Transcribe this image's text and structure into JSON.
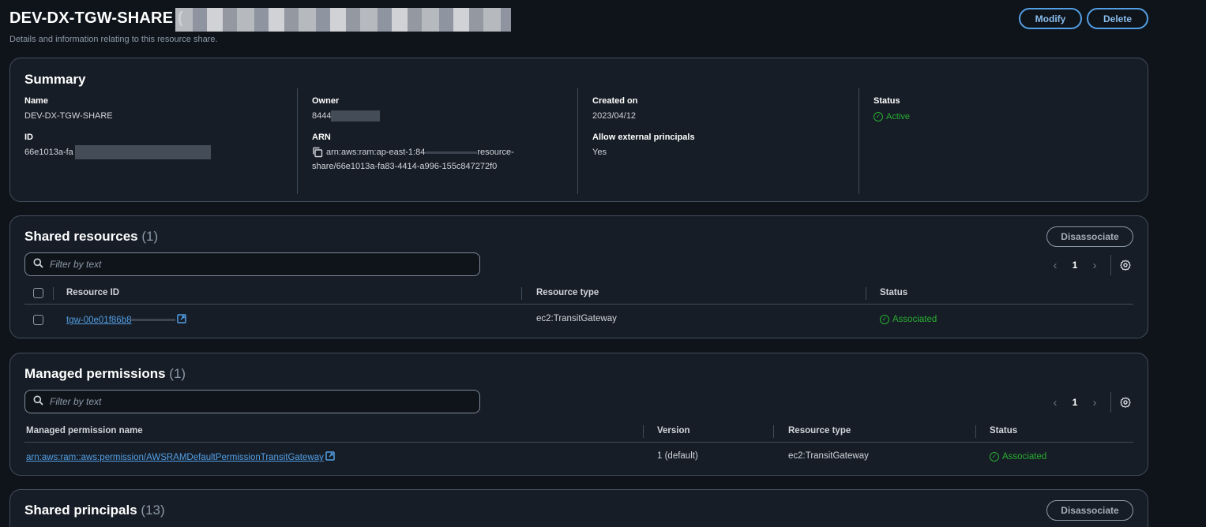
{
  "header": {
    "title": "DEV-DX-TGW-SHARE (",
    "description": "Details and information relating to this resource share.",
    "modify_label": "Modify",
    "delete_label": "Delete"
  },
  "summary": {
    "title": "Summary",
    "name_label": "Name",
    "name_value": "DEV-DX-TGW-SHARE",
    "id_label": "ID",
    "id_value": "66e1013a-fa",
    "owner_label": "Owner",
    "owner_value": "8444",
    "arn_label": "ARN",
    "arn_line1_prefix": "arn:aws:ram:ap-east-1:84",
    "arn_line1_suffix": "resource-",
    "arn_line2": "share/66e1013a-fa83-4414-a996-155c847272f0",
    "created_label": "Created on",
    "created_value": "2023/04/12",
    "external_label": "Allow external principals",
    "external_value": "Yes",
    "status_label": "Status",
    "status_value": "Active"
  },
  "shared_resources": {
    "title": "Shared resources",
    "count": "(1)",
    "disassociate_label": "Disassociate",
    "filter_placeholder": "Filter by text",
    "page": "1",
    "columns": [
      "Resource ID",
      "Resource type",
      "Status"
    ],
    "rows": [
      {
        "resource_id": "tgw-00e01f86b8",
        "resource_type": "ec2:TransitGateway",
        "status": "Associated"
      }
    ]
  },
  "managed_permissions": {
    "title": "Managed permissions",
    "count": "(1)",
    "filter_placeholder": "Filter by text",
    "page": "1",
    "columns": [
      "Managed permission name",
      "Version",
      "Resource type",
      "Status"
    ],
    "rows": [
      {
        "name": "arn:aws:ram::aws:permission/AWSRAMDefaultPermissionTransitGateway",
        "version": "1 (default)",
        "resource_type": "ec2:TransitGateway",
        "status": "Associated"
      }
    ]
  },
  "shared_principals": {
    "title": "Shared principals",
    "count": "(13)",
    "disassociate_label": "Disassociate"
  },
  "colors": {
    "background": "#0f141a",
    "panel": "#161d26",
    "accent": "#539fe5",
    "success": "#29ad32"
  },
  "icons": [
    "search-icon",
    "copy-icon",
    "external-link-icon",
    "check-circle-icon",
    "chevron-left-icon",
    "chevron-right-icon",
    "settings-gear-icon"
  ]
}
